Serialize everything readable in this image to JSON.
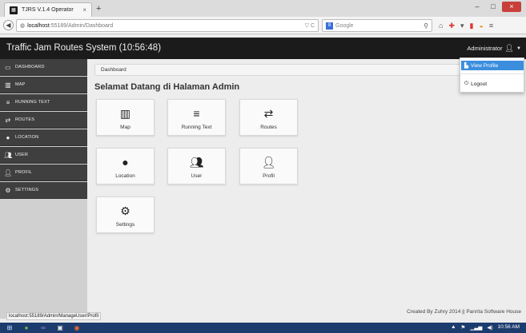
{
  "browser": {
    "tab_title": "TJRS V.1.4 Operator",
    "tab_close": "×",
    "new_tab": "+",
    "url_host": "localhost",
    "url_path": ":55189/Admin/Dashboard",
    "url_reload": "▽ C",
    "search_engine": "Google",
    "window_buttons": [
      "–",
      "□",
      "×"
    ]
  },
  "app": {
    "brand": "Traffic Jam Routes System (10:56:48)",
    "user_name": "Administrator",
    "user_icon": "user-icon"
  },
  "dropdown": {
    "view_profile": "View Profile",
    "logout": "Logout"
  },
  "sidebar": {
    "items": [
      {
        "label": "DASHBOARD",
        "icon": "monitor-icon"
      },
      {
        "label": "MAP",
        "icon": "map-icon"
      },
      {
        "label": "RUNNING TEXT",
        "icon": "list-icon"
      },
      {
        "label": "ROUTES",
        "icon": "shuffle-icon"
      },
      {
        "label": "LOCATION",
        "icon": "map-marker-icon"
      },
      {
        "label": "USER",
        "icon": "users-icon"
      },
      {
        "label": "PROFIL",
        "icon": "user-icon"
      },
      {
        "label": "SETTINGS",
        "icon": "gear-icon"
      }
    ]
  },
  "main": {
    "breadcrumb": "Dashboard",
    "title": "Selamat Datang di Halaman Admin",
    "tiles": [
      {
        "label": "Map",
        "icon": "map-icon"
      },
      {
        "label": "Running Text",
        "icon": "list-icon"
      },
      {
        "label": "Routes",
        "icon": "shuffle-icon"
      },
      {
        "label": "Location",
        "icon": "map-marker-icon"
      },
      {
        "label": "User",
        "icon": "users-icon"
      },
      {
        "label": "Profil",
        "icon": "user-icon"
      },
      {
        "label": "Settings",
        "icon": "gear-icon"
      }
    ],
    "credit": "Created By Zuhry 2014 || Panrita Software House"
  },
  "status_url": "localhost:55189/Admin/ManageUser/Profil",
  "taskbar": {
    "time": "10:56 AM"
  },
  "colors": {
    "appbar": "#1b1b1b",
    "sidebar_item": "#3f3f3f",
    "accent": "#3b8ede"
  }
}
